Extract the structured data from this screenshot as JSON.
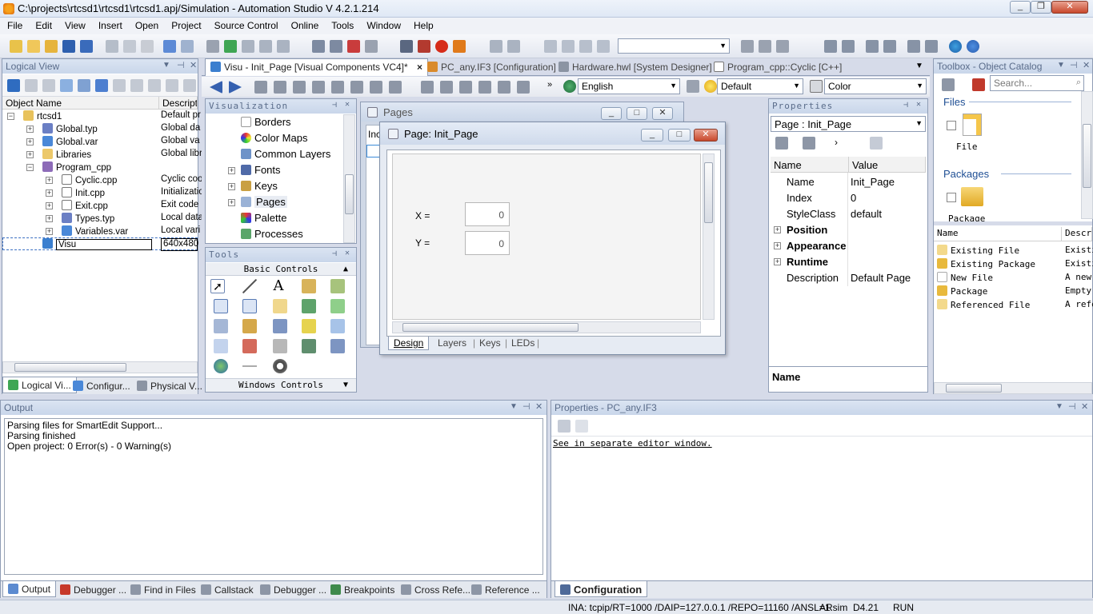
{
  "app": {
    "title": "C:\\projects\\rtcsd1\\rtcsd1\\rtcsd1.apj/Simulation - Automation Studio V 4.2.1.214"
  },
  "menu": [
    "File",
    "Edit",
    "View",
    "Insert",
    "Open",
    "Project",
    "Source Control",
    "Online",
    "Tools",
    "Window",
    "Help"
  ],
  "logical_view": {
    "title": "Logical View",
    "col_name": "Object Name",
    "col_desc": "Descriptic",
    "items": [
      {
        "label": "rtcsd1",
        "desc": "Default pr"
      },
      {
        "label": "Global.typ",
        "desc": "Global da"
      },
      {
        "label": "Global.var",
        "desc": "Global va"
      },
      {
        "label": "Libraries",
        "desc": "Global libr"
      },
      {
        "label": "Program_cpp",
        "desc": ""
      },
      {
        "label": "Cyclic.cpp",
        "desc": "Cyclic coo"
      },
      {
        "label": "Init.cpp",
        "desc": "Initializatio"
      },
      {
        "label": "Exit.cpp",
        "desc": "Exit code"
      },
      {
        "label": "Types.typ",
        "desc": "Local data"
      },
      {
        "label": "Variables.var",
        "desc": "Local vari"
      },
      {
        "label": "Visu",
        "desc": "640x480"
      }
    ],
    "tabs": [
      "Logical Vi...",
      "Configur...",
      "Physical V..."
    ]
  },
  "editor_tabs": [
    {
      "label": "Visu - Init_Page [Visual Components VC4]*",
      "close": "×"
    },
    {
      "label": "PC_any.IF3 [Configuration]"
    },
    {
      "label": "Hardware.hwl [System Designer]"
    },
    {
      "label": "Program_cpp::Cyclic [C++]"
    }
  ],
  "vc_toolbar": {
    "language": "English",
    "style": "Default",
    "color": "Color"
  },
  "visualization": {
    "title": "Visualization",
    "items": [
      "Borders",
      "Color Maps",
      "Common Layers",
      "Fonts",
      "Keys",
      "Pages",
      "Palette",
      "Processes"
    ]
  },
  "tools": {
    "title": "Tools",
    "basic_controls": "Basic Controls",
    "windows_controls": "Windows Controls"
  },
  "pages_window": {
    "title": "Pages",
    "col": "Inc"
  },
  "page_window": {
    "title": "Page: Init_Page",
    "x_label": "X =",
    "x_value": "0",
    "y_label": "Y =",
    "y_value": "0",
    "tabs": [
      "Design",
      "Layers",
      "Keys",
      "LEDs"
    ]
  },
  "properties": {
    "title": "Properties",
    "selector": "Page : Init_Page",
    "col_name": "Name",
    "col_value": "Value",
    "rows": [
      {
        "name": "Name",
        "value": "Init_Page"
      },
      {
        "name": "Index",
        "value": "0"
      },
      {
        "name": "StyleClass",
        "value": "default"
      }
    ],
    "categories": [
      "Position",
      "Appearance",
      "Runtime"
    ],
    "description": {
      "name": "Description",
      "value": "Default Page"
    },
    "footer_label": "Name"
  },
  "toolbox": {
    "title": "Toolbox - Object Catalog",
    "search_placeholder": "Search...",
    "files_section": "Files",
    "file_item": "File",
    "packages_section": "Packages",
    "package_item": "Package",
    "col_name": "Name",
    "col_desc": "Descri",
    "rows": [
      {
        "name": "Existing File",
        "desc": "Existi"
      },
      {
        "name": "Existing Package",
        "desc": "Existi"
      },
      {
        "name": "New File",
        "desc": "A new"
      },
      {
        "name": "Package",
        "desc": "Empty"
      },
      {
        "name": "Referenced File",
        "desc": "A refe"
      }
    ]
  },
  "output": {
    "title": "Output",
    "lines": [
      "Parsing files for SmartEdit Support...",
      "Parsing finished",
      "Open project: 0 Error(s) - 0 Warning(s)"
    ],
    "tabs": [
      "Output",
      "Debugger ...",
      "Find in Files",
      "Callstack",
      "Debugger ...",
      "Breakpoints",
      "Cross Refe...",
      "Reference ..."
    ]
  },
  "properties_if3": {
    "title": "Properties - PC_any.IF3",
    "link": "See in separate editor window.",
    "tab": "Configuration"
  },
  "statusbar": {
    "connection": "INA: tcpip/RT=1000 /DAIP=127.0.0.1 /REPO=11160 /ANSL=1",
    "target": "ARsim  D4.21",
    "state": "RUN"
  }
}
